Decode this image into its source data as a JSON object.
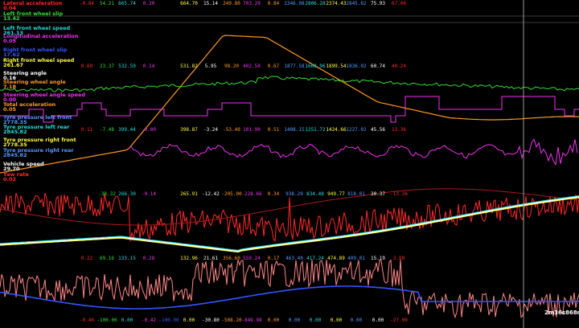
{
  "colors": {
    "background": "#000000",
    "cursor": "#9a9a9a",
    "separator": "#3a3a3a"
  },
  "cursor_time": "2m36s868ms",
  "channels": [
    {
      "label": "Lateral acceleration",
      "value": "0.04",
      "color": "#ff2a2a"
    },
    {
      "label": "Left front wheel slip",
      "value": "13.42",
      "color": "#33dd33"
    },
    {
      "label": "Left front wheel speed",
      "value": "261.13",
      "color": "#22dddd"
    },
    {
      "label": "Longitudinal acceleration",
      "value": "0.05",
      "color": "#ee33ee"
    },
    {
      "label": "Right front wheel slip",
      "value": "17.62",
      "color": "#3355ff"
    },
    {
      "label": "Right front wheel speed",
      "value": "261.67",
      "color": "#ffff33"
    },
    {
      "label": "Steering angle",
      "value": "0.16",
      "color": "#ffffff"
    },
    {
      "label": "Steering wheel angle",
      "value": "7.18",
      "color": "#ff9922"
    },
    {
      "label": "Steering wheel angle speed",
      "value": "0.00",
      "color": "#ee33ee"
    },
    {
      "label": "Total acceleration",
      "value": "0.05",
      "color": "#ff9922"
    },
    {
      "label": "Tyre pressure left front",
      "value": "2778.35",
      "color": "#5599ff"
    },
    {
      "label": "Tyre pressure left rear",
      "value": "2845.82",
      "color": "#22dddd"
    },
    {
      "label": "Tyre pressure right front",
      "value": "2778.35",
      "color": "#ffff33"
    },
    {
      "label": "Tyre pressure right rear",
      "value": "2845.82",
      "color": "#5599ff"
    },
    {
      "label": "Vehicle speed",
      "value": "29.70",
      "color": "#ffffff"
    },
    {
      "label": "Yaw rate",
      "value": "0.02",
      "color": "#ff2a2a"
    }
  ],
  "stat_rows": [
    [
      {
        "text": "-0.84",
        "color": "#ff2a2a"
      },
      {
        "text": "54.21",
        "color": "#33dd33"
      },
      {
        "text": "665.74",
        "color": "#22dddd"
      },
      {
        "text": "0.20",
        "color": "#ee33ee"
      },
      {
        "text": "",
        "color": "#3355ff"
      },
      {
        "text": "664.70",
        "color": "#ffff33"
      },
      {
        "text": "15.14",
        "color": "#ffffff"
      },
      {
        "text": "249.80",
        "color": "#ff9922"
      },
      {
        "text": "703.29",
        "color": "#ee33ee"
      },
      {
        "text": "0.84",
        "color": "#ff9922"
      },
      {
        "text": "2346.98",
        "color": "#5599ff"
      },
      {
        "text": "2806.28",
        "color": "#22dddd"
      },
      {
        "text": "2374.43",
        "color": "#ffff33"
      },
      {
        "text": "2845.82",
        "color": "#5599ff"
      },
      {
        "text": "75.93",
        "color": "#ffffff"
      },
      {
        "text": "67.06",
        "color": "#ff2a2a"
      }
    ],
    [
      {
        "text": "0.60",
        "color": "#ff2a2a"
      },
      {
        "text": "23.37",
        "color": "#33dd33"
      },
      {
        "text": "532.59",
        "color": "#22dddd"
      },
      {
        "text": "0.14",
        "color": "#ee33ee"
      },
      {
        "text": "",
        "color": "#3355ff"
      },
      {
        "text": "531.82",
        "color": "#ffff33"
      },
      {
        "text": "5.95",
        "color": "#ffffff"
      },
      {
        "text": "98.20",
        "color": "#ff9922"
      },
      {
        "text": "402.50",
        "color": "#ee33ee"
      },
      {
        "text": "0.67",
        "color": "#ff9922"
      },
      {
        "text": "1877.58",
        "color": "#5599ff"
      },
      {
        "text": "1668.96",
        "color": "#22dddd"
      },
      {
        "text": "1899.54",
        "color": "#ffff33"
      },
      {
        "text": "1836.02",
        "color": "#5599ff"
      },
      {
        "text": "60.74",
        "color": "#ffffff"
      },
      {
        "text": "40.24",
        "color": "#ff2a2a"
      }
    ],
    [
      {
        "text": "0.11",
        "color": "#ff2a2a"
      },
      {
        "text": "-7.48",
        "color": "#33dd33"
      },
      {
        "text": "399.44",
        "color": "#22dddd"
      },
      {
        "text": "-0.00",
        "color": "#ee33ee"
      },
      {
        "text": "",
        "color": "#3355ff"
      },
      {
        "text": "398.87",
        "color": "#ffff33"
      },
      {
        "text": "-3.24",
        "color": "#ffffff"
      },
      {
        "text": "-53.40",
        "color": "#ff9922"
      },
      {
        "text": "101.90",
        "color": "#ee33ee"
      },
      {
        "text": "0.51",
        "color": "#ff9922"
      },
      {
        "text": "1408.15",
        "color": "#5599ff"
      },
      {
        "text": "1251.72",
        "color": "#22dddd"
      },
      {
        "text": "1424.66",
        "color": "#ffff33"
      },
      {
        "text": "1227.02",
        "color": "#5599ff"
      },
      {
        "text": "45.56",
        "color": "#ffffff"
      },
      {
        "text": "13.36",
        "color": "#ff2a2a"
      }
    ],
    [
      {
        "text": "",
        "color": "#ff2a2a"
      },
      {
        "text": "-38.32",
        "color": "#33dd33"
      },
      {
        "text": "266.30",
        "color": "#22dddd"
      },
      {
        "text": "-0.14",
        "color": "#ee33ee"
      },
      {
        "text": "",
        "color": "#3355ff"
      },
      {
        "text": "265.91",
        "color": "#ffff33"
      },
      {
        "text": "-12.42",
        "color": "#ffffff"
      },
      {
        "text": "-205.00",
        "color": "#ff9922"
      },
      {
        "text": "-228.66",
        "color": "#ee33ee"
      },
      {
        "text": "0.34",
        "color": "#ff9922"
      },
      {
        "text": "938.29",
        "color": "#5599ff"
      },
      {
        "text": "834.48",
        "color": "#22dddd"
      },
      {
        "text": "949.77",
        "color": "#ffff33"
      },
      {
        "text": "818.01",
        "color": "#5599ff"
      },
      {
        "text": "30.37",
        "color": "#ffffff"
      },
      {
        "text": "-13.26",
        "color": "#ff2a2a"
      }
    ],
    [
      {
        "text": "0.22",
        "color": "#ff2a2a"
      },
      {
        "text": "69.16",
        "color": "#33dd33"
      },
      {
        "text": "133.15",
        "color": "#22dddd"
      },
      {
        "text": "0.28",
        "color": "#ee33ee"
      },
      {
        "text": "",
        "color": "#3355ff"
      },
      {
        "text": "132.96",
        "color": "#ffff33"
      },
      {
        "text": "21.61",
        "color": "#ffffff"
      },
      {
        "text": "356.60",
        "color": "#ff9922"
      },
      {
        "text": "559.24",
        "color": "#ee33ee"
      },
      {
        "text": "0.17",
        "color": "#ff9922"
      },
      {
        "text": "463.40",
        "color": "#5599ff"
      },
      {
        "text": "417.24",
        "color": "#22dddd"
      },
      {
        "text": "474.89",
        "color": "#ffff33"
      },
      {
        "text": "409.01",
        "color": "#5599ff"
      },
      {
        "text": "15.19",
        "color": "#ffffff"
      },
      {
        "text": "3.88",
        "color": "#ff2a2a"
      }
    ],
    [
      {
        "text": "-0.46",
        "color": "#ff2a2a"
      },
      {
        "text": "-100.00",
        "color": "#33dd33"
      },
      {
        "text": "0.00",
        "color": "#22dddd"
      },
      {
        "text": "-0.42",
        "color": "#ee33ee"
      },
      {
        "text": "-100.00",
        "color": "#3355ff"
      },
      {
        "text": "0.00",
        "color": "#ffff33"
      },
      {
        "text": "-30.80",
        "color": "#ffffff"
      },
      {
        "text": "-508.20",
        "color": "#ff9922"
      },
      {
        "text": "-849.98",
        "color": "#ee33ee"
      },
      {
        "text": "0.00",
        "color": "#ff9922"
      },
      {
        "text": "0.00",
        "color": "#5599ff"
      },
      {
        "text": "0.00",
        "color": "#22dddd"
      },
      {
        "text": "0.00",
        "color": "#ffff33"
      },
      {
        "text": "0.00",
        "color": "#5599ff"
      },
      {
        "text": "0.00",
        "color": "#ffffff"
      },
      {
        "text": "-27.00",
        "color": "#ff2a2a"
      }
    ]
  ]
}
